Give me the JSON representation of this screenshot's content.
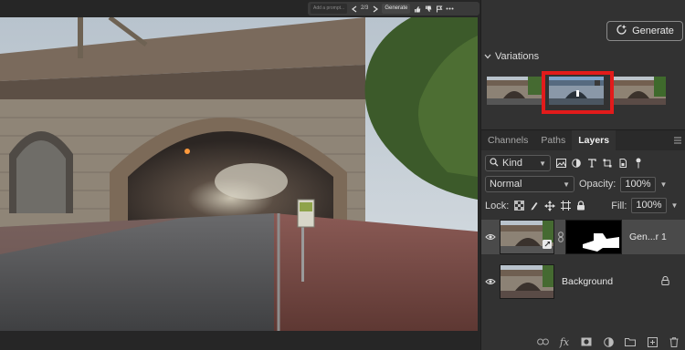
{
  "context_bar": {
    "prompt_placeholder": "Add a prompt...",
    "page_counter": "2/3",
    "generate_label": "Generate"
  },
  "panel": {
    "generate_button_label": "Generate",
    "variations_title": "Variations",
    "tabs": [
      {
        "label": "Channels",
        "active": false
      },
      {
        "label": "Paths",
        "active": false
      },
      {
        "label": "Layers",
        "active": true
      }
    ],
    "filter": {
      "kind_label": "Kind"
    },
    "blend_mode": "Normal",
    "opacity_label": "Opacity:",
    "opacity_value": "100%",
    "lock_label": "Lock:",
    "fill_label": "Fill:",
    "fill_value": "100%",
    "layers": [
      {
        "name": "Gen...r 1",
        "selected": true,
        "has_mask": true
      },
      {
        "name": "Background",
        "selected": false,
        "locked": true
      }
    ]
  },
  "colors": {
    "panel_bg": "#323232",
    "selection_highlight": "#e21b1b",
    "selected_layer_bg": "#4a4a4a"
  }
}
